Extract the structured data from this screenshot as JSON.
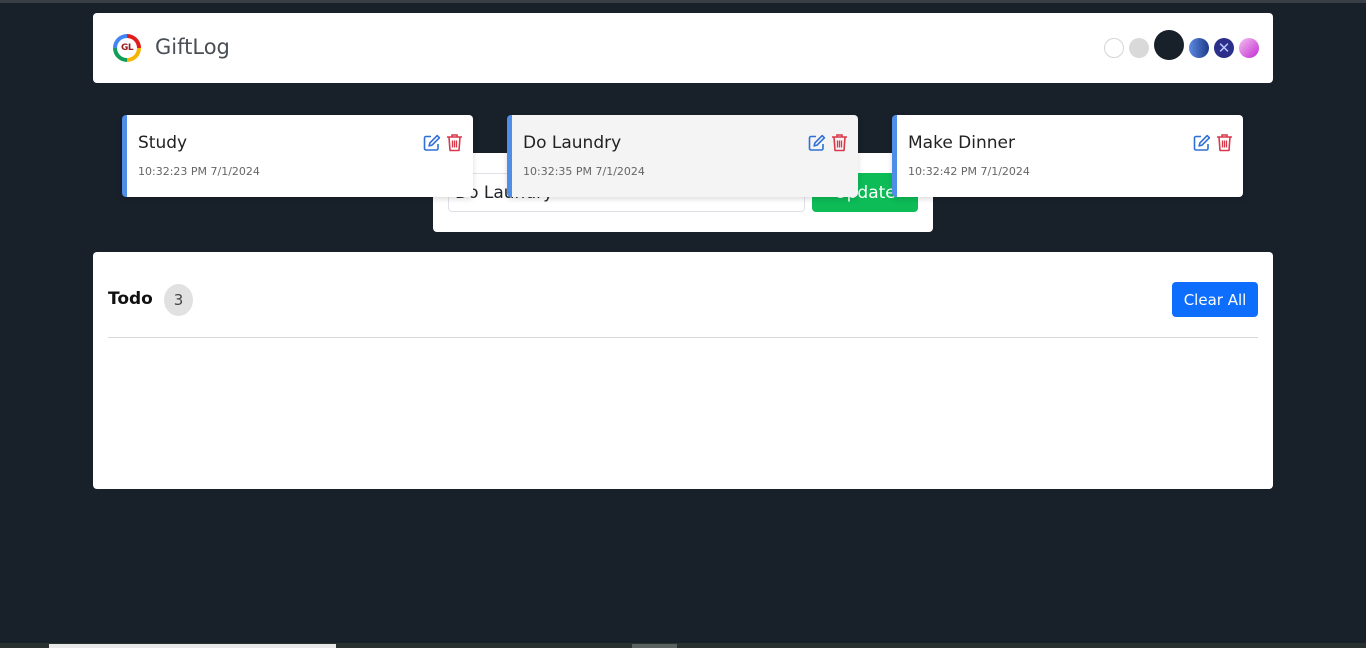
{
  "navbar": {
    "logo_text": "GL",
    "brand": "GiftLog",
    "themes": [
      "white-theme",
      "light-theme",
      "dark-theme",
      "blue-theme",
      "x-theme",
      "pink-theme"
    ]
  },
  "form": {
    "input_value": "Do Laundry",
    "submit_label": "Update",
    "submit_color": "#0dbb57"
  },
  "list": {
    "title": "Todo",
    "count": "3",
    "clear_label": "Clear All",
    "clear_color": "#0d6efd",
    "accent_color": "#4f8de6",
    "items": [
      {
        "text": "Study",
        "time": "10:32:23 PM 7/1/2024"
      },
      {
        "text": "Do Laundry",
        "time": "10:32:35 PM 7/1/2024"
      },
      {
        "text": "Make Dinner",
        "time": "10:32:42 PM 7/1/2024"
      }
    ]
  },
  "icons": {
    "edit": "edit-icon",
    "delete": "trash-icon"
  }
}
